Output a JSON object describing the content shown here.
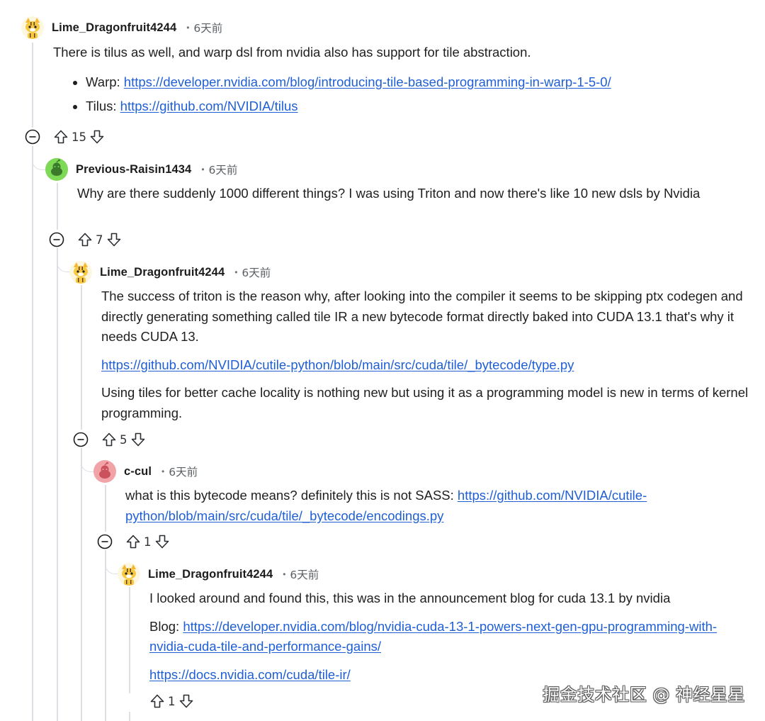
{
  "comments": [
    {
      "author": "Lime_Dragonfruit4244",
      "avatar_icon": "tiger-avatar-icon",
      "time": "6天前",
      "text": "There is tilus as well, and warp dsl from nvidia also has support for tile abstraction.",
      "bullets": [
        {
          "label": "Warp: ",
          "link": "https://developer.nvidia.com/blog/introducing-tile-based-programming-in-warp-1-5-0/"
        },
        {
          "label": "Tilus: ",
          "link": "https://github.com/NVIDIA/tilus"
        }
      ],
      "votes": "15"
    },
    {
      "author": "Previous-Raisin1434",
      "avatar_icon": "green-snoo-avatar-icon",
      "time": "6天前",
      "text": "Why are there suddenly 1000 different things? I was using Triton and now there's like 10 new dsls by Nvidia",
      "votes": "7"
    },
    {
      "author": "Lime_Dragonfruit4244",
      "avatar_icon": "tiger-avatar-icon",
      "time": "6天前",
      "text": "The success of triton is the reason why, after looking into the compiler it seems to be skipping ptx codegen and directly generating something called tile IR a new bytecode format directly baked into CUDA 13.1 that's why it needs CUDA 13.",
      "link": "https://github.com/NVIDIA/cutile-python/blob/main/src/cuda/tile/_bytecode/type.py",
      "text2": "Using tiles for better cache locality is nothing new but using it as a programming model is new in terms of kernel programming.",
      "votes": "5"
    },
    {
      "author": "c-cul",
      "avatar_icon": "red-snoo-avatar-icon",
      "time": "6天前",
      "text": "what is this bytecode means? definitely this is not SASS: ",
      "link": "https://github.com/NVIDIA/cutile-python/blob/main/src/cuda/tile/_bytecode/encodings.py",
      "votes": "1"
    },
    {
      "author": "Lime_Dragonfruit4244",
      "avatar_icon": "tiger-avatar-icon",
      "time": "6天前",
      "text": "I looked around and found this, this was in the announcement blog for cuda 13.1 by nvidia",
      "blog_label": "Blog: ",
      "link": "https://developer.nvidia.com/blog/nvidia-cuda-13-1-powers-next-gen-gpu-programming-with-nvidia-cuda-tile-and-performance-gains/",
      "link2": "https://docs.nvidia.com/cuda/tile-ir/",
      "votes": "1"
    }
  ],
  "watermark": "掘金技术社区 @ 神经星星",
  "colors": {
    "link": "#1f5fd6",
    "thread_line": "#dcdfe3",
    "green_avatar": "#7ed957",
    "red_avatar": "#f1a3a8"
  }
}
